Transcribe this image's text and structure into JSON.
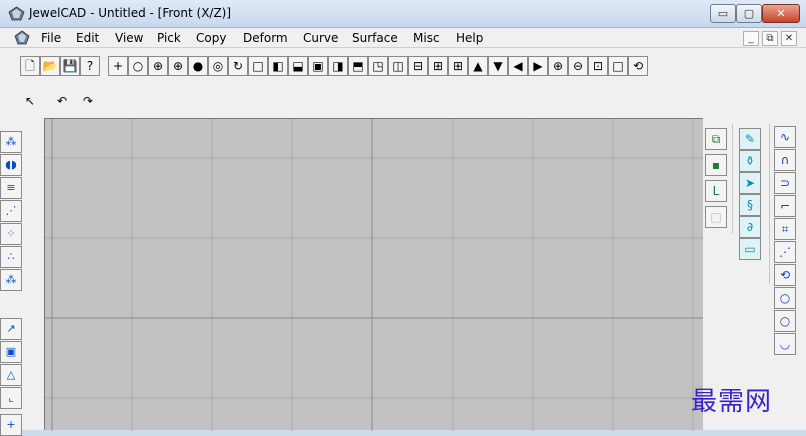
{
  "window": {
    "title": "JewelCAD - Untitled - [Front (X/Z)]",
    "controls": {
      "minimize": "▭",
      "maximize": "▢",
      "close": "✕"
    }
  },
  "menu": {
    "items": [
      "File",
      "Edit",
      "View",
      "Pick",
      "Copy",
      "Deform",
      "Curve",
      "Surface",
      "Misc",
      "Help"
    ],
    "mdi_controls": {
      "minimize": "_",
      "restore": "⧉",
      "close": "✕"
    }
  },
  "main_toolbar": [
    {
      "icon": "new-file-icon",
      "glyph": "🗋"
    },
    {
      "icon": "open-folder-icon",
      "glyph": "📂"
    },
    {
      "icon": "save-icon",
      "glyph": "💾"
    },
    {
      "icon": "help-cursor-icon",
      "glyph": "?"
    },
    {
      "icon": "origin-cross-icon",
      "glyph": "+"
    },
    {
      "icon": "circle-icon",
      "glyph": "○"
    },
    {
      "icon": "circle-cross-icon",
      "glyph": "⊕"
    },
    {
      "icon": "circle-dot-cross-icon",
      "glyph": "⊕"
    },
    {
      "icon": "filled-circle-icon",
      "glyph": "●"
    },
    {
      "icon": "ring-icon",
      "glyph": "◎"
    },
    {
      "icon": "rotate-view-icon",
      "glyph": "↻"
    },
    {
      "icon": "view-single-icon",
      "glyph": "□"
    },
    {
      "icon": "view-left-icon",
      "glyph": "◧"
    },
    {
      "icon": "view-bottom-icon",
      "glyph": "⬓"
    },
    {
      "icon": "view-frame-icon",
      "glyph": "▣"
    },
    {
      "icon": "view-right-icon",
      "glyph": "◨"
    },
    {
      "icon": "view-top-icon",
      "glyph": "⬒"
    },
    {
      "icon": "view-bottom-left-icon",
      "glyph": "◳"
    },
    {
      "icon": "split-vertical-icon",
      "glyph": "◫"
    },
    {
      "icon": "split-horizontal-icon",
      "glyph": "⊟"
    },
    {
      "icon": "four-views-icon",
      "glyph": "⊞"
    },
    {
      "icon": "four-views-bold-icon",
      "glyph": "⊞"
    },
    {
      "icon": "arrow-up-icon",
      "glyph": "▲"
    },
    {
      "icon": "arrow-down-icon",
      "glyph": "▼"
    },
    {
      "icon": "arrow-left-icon",
      "glyph": "◀"
    },
    {
      "icon": "arrow-right-icon",
      "glyph": "▶"
    },
    {
      "icon": "zoom-in-icon",
      "glyph": "⊕"
    },
    {
      "icon": "zoom-out-icon",
      "glyph": "⊖"
    },
    {
      "icon": "zoom-window-icon",
      "glyph": "⊡"
    },
    {
      "icon": "zoom-fit-icon",
      "glyph": "□"
    },
    {
      "icon": "more-icon",
      "glyph": "⟲"
    }
  ],
  "secondary_toolbar": [
    {
      "icon": "select-arrow-icon",
      "glyph": "↖"
    },
    {
      "icon": "undo-icon",
      "glyph": "↶"
    },
    {
      "icon": "redo-icon",
      "glyph": "↷"
    }
  ],
  "left_toolbar": [
    {
      "icon": "pick-object-icon",
      "glyph": "⁂"
    },
    {
      "icon": "mirror-pair-icon",
      "glyph": "◖◗"
    },
    {
      "icon": "stack-vertical-icon",
      "glyph": "≡"
    },
    {
      "icon": "diagonal-points-icon",
      "glyph": "⋰"
    },
    {
      "icon": "grid-points-icon",
      "glyph": "⁘"
    },
    {
      "icon": "scatter-points-icon",
      "glyph": "∴"
    },
    {
      "icon": "ring-points-icon",
      "glyph": "⁂"
    },
    {
      "icon": "select-region-icon",
      "glyph": "↗"
    },
    {
      "icon": "select-box-icon",
      "glyph": "▣"
    },
    {
      "icon": "triangle-icon",
      "glyph": "△"
    },
    {
      "icon": "corner-select-icon",
      "glyph": "⌞"
    },
    {
      "icon": "cross-icon",
      "glyph": "+"
    }
  ],
  "right_toolbar_1": [
    {
      "icon": "duplicate-icon",
      "glyph": "⧉"
    },
    {
      "icon": "point-icon",
      "glyph": "▪"
    },
    {
      "icon": "corner-icon",
      "glyph": "L"
    },
    {
      "icon": "disabled-icon",
      "glyph": "□"
    }
  ],
  "right_toolbar_2": [
    {
      "icon": "pen-icon",
      "glyph": "✎"
    },
    {
      "icon": "bottle-icon",
      "glyph": "⚱"
    },
    {
      "icon": "fish-icon",
      "glyph": "➤"
    },
    {
      "icon": "spiral-icon",
      "glyph": "§"
    },
    {
      "icon": "curl-icon",
      "glyph": "∂"
    },
    {
      "icon": "bread-icon",
      "glyph": "▭"
    }
  ],
  "right_toolbar_3": [
    {
      "icon": "curve-smooth-icon",
      "glyph": "∿"
    },
    {
      "icon": "curve-arch-icon",
      "glyph": "∩"
    },
    {
      "icon": "curve-loop-icon",
      "glyph": "⊃"
    },
    {
      "icon": "curve-step-icon",
      "glyph": "⌐"
    },
    {
      "icon": "curve-box-icon",
      "glyph": "⌗"
    },
    {
      "icon": "curve-dashed-icon",
      "glyph": "⋰"
    },
    {
      "icon": "curve-ring-icon",
      "glyph": "⟲"
    },
    {
      "icon": "circle-small-icon",
      "glyph": "○"
    },
    {
      "icon": "circle-large-icon",
      "glyph": "○"
    },
    {
      "icon": "arc-icon",
      "glyph": "◡"
    }
  ],
  "watermark": "最需网"
}
